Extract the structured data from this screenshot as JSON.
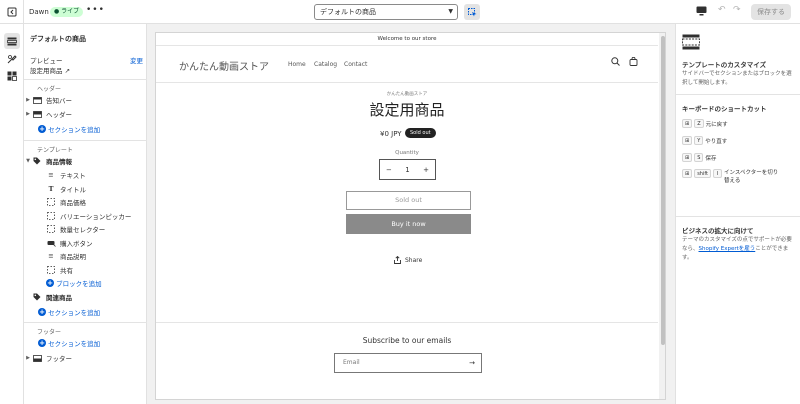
{
  "topbar": {
    "theme_name": "Dawn",
    "live_badge": "ライブ",
    "more": "•••",
    "template_select": "デフォルトの商品",
    "save_label": "保存する"
  },
  "sidebar": {
    "title": "デフォルトの商品",
    "preview_label": "プレビュー",
    "change_link": "変更",
    "preview_value": "設定用商品",
    "header_group": "ヘッダー",
    "header_items": [
      "告知バー",
      "ヘッダー"
    ],
    "add_section": "セクションを追加",
    "template_group": "テンプレート",
    "product_info": "商品情報",
    "blocks": [
      "テキスト",
      "タイトル",
      "商品価格",
      "バリエーションピッカー",
      "数量セレクター",
      "購入ボタン",
      "商品説明",
      "共有"
    ],
    "add_block": "ブロックを追加",
    "related": "関連商品",
    "footer_group": "フッター",
    "footer_item": "フッター"
  },
  "store": {
    "announcement": "Welcome to our store",
    "logo": "かんたん動画ストア",
    "nav": [
      "Home",
      "Catalog",
      "Contact"
    ],
    "vendor": "かんたん動画ストア",
    "product_title": "設定用商品",
    "price": "¥0 JPY",
    "sold_out_badge": "Sold out",
    "quantity_label": "Quantity",
    "quantity_value": "1",
    "sold_out_button": "Sold out",
    "buy_button": "Buy it now",
    "share": "Share",
    "subscribe_title": "Subscribe to our emails",
    "email_placeholder": "Email"
  },
  "rpanel": {
    "customize_title": "テンプレートのカスタマイズ",
    "customize_desc": "サイドバーでセクションまたはブロックを選択して開始します。",
    "shortcuts_title": "キーボードのショートカット",
    "shortcuts": [
      {
        "keys": [
          "⊞",
          "Z"
        ],
        "label": "元に戻す"
      },
      {
        "keys": [
          "⊞",
          "Y"
        ],
        "label": "やり直す"
      },
      {
        "keys": [
          "⊞",
          "S"
        ],
        "label": "保存"
      },
      {
        "keys": [
          "⊞",
          "shift",
          "I"
        ],
        "label": "インスペクターを切り替える"
      }
    ],
    "growth_title": "ビジネスの拡大に向けて",
    "growth_desc_1": "テーマのカスタマイズの点でサポートが必要なら、",
    "growth_link": "Shopify Expertを雇う",
    "growth_desc_2": "ことができます。"
  },
  "colors": {
    "accent": "#005bd3",
    "live_bg": "#cdfed4",
    "buy_button": "#8a8a8a"
  },
  "icons": [
    "exit-icon",
    "more-icon",
    "chevron-down-icon",
    "inspector-icon",
    "desktop-icon",
    "undo-icon",
    "redo-icon",
    "sections-icon",
    "settings-icon",
    "apps-icon",
    "search-icon",
    "cart-icon",
    "share-icon",
    "layout-icon"
  ]
}
